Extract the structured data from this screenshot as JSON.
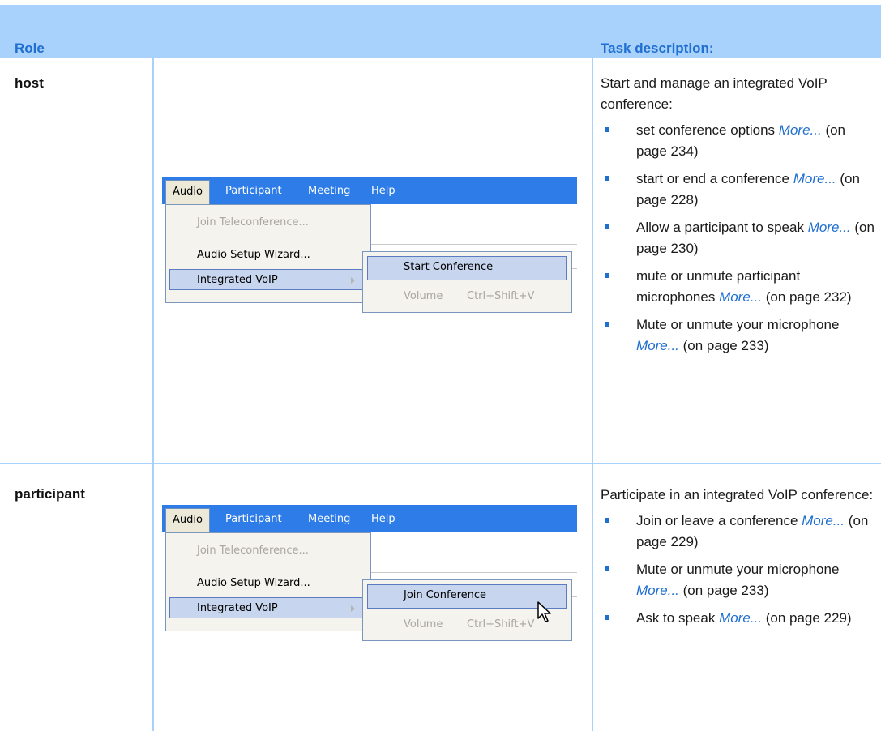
{
  "header": {
    "col_role": "Role",
    "col_desc": "Task description:"
  },
  "rows": [
    {
      "role": "host",
      "intro": "Start and manage an integrated VoIP conference:",
      "items": [
        {
          "text": "set conference options",
          "link": "More...",
          "page": "(on page 234)"
        },
        {
          "text": "start or end a conference",
          "link": "More...",
          "page": "(on page 228)"
        },
        {
          "text": "Allow a participant to speak",
          "link": "More...",
          "page": "(on page 230)"
        },
        {
          "text": "mute or unmute participant microphones",
          "link": "More...",
          "page": "(on page 232)"
        },
        {
          "text": "Mute or unmute your microphone",
          "link": "More...",
          "page": "(on page 233)"
        }
      ],
      "menu": {
        "bar": [
          "Audio",
          "Participant",
          "Meeting",
          "Help"
        ],
        "items": [
          "Join Teleconference...",
          "Audio Setup Wizard...",
          "Integrated VoIP"
        ],
        "submenu": [
          "Start Conference",
          "Volume",
          "Ctrl+Shift+V"
        ]
      }
    },
    {
      "role": "participant",
      "intro": "Participate in an integrated VoIP conference:",
      "items": [
        {
          "text": "Join or leave a conference",
          "link": "More...",
          "page": "(on page 229)"
        },
        {
          "text": "Mute or unmute your microphone",
          "link": "More...",
          "page": "(on page 233)"
        },
        {
          "text": "Ask to speak",
          "link": "More...",
          "page": "(on page 229)"
        }
      ],
      "menu": {
        "bar": [
          "Audio",
          "Participant",
          "Meeting",
          "Help"
        ],
        "items": [
          "Join Teleconference...",
          "Audio Setup Wizard...",
          "Integrated VoIP"
        ],
        "submenu": [
          "Join Conference",
          "Volume",
          "Ctrl+Shift+V"
        ]
      }
    }
  ]
}
